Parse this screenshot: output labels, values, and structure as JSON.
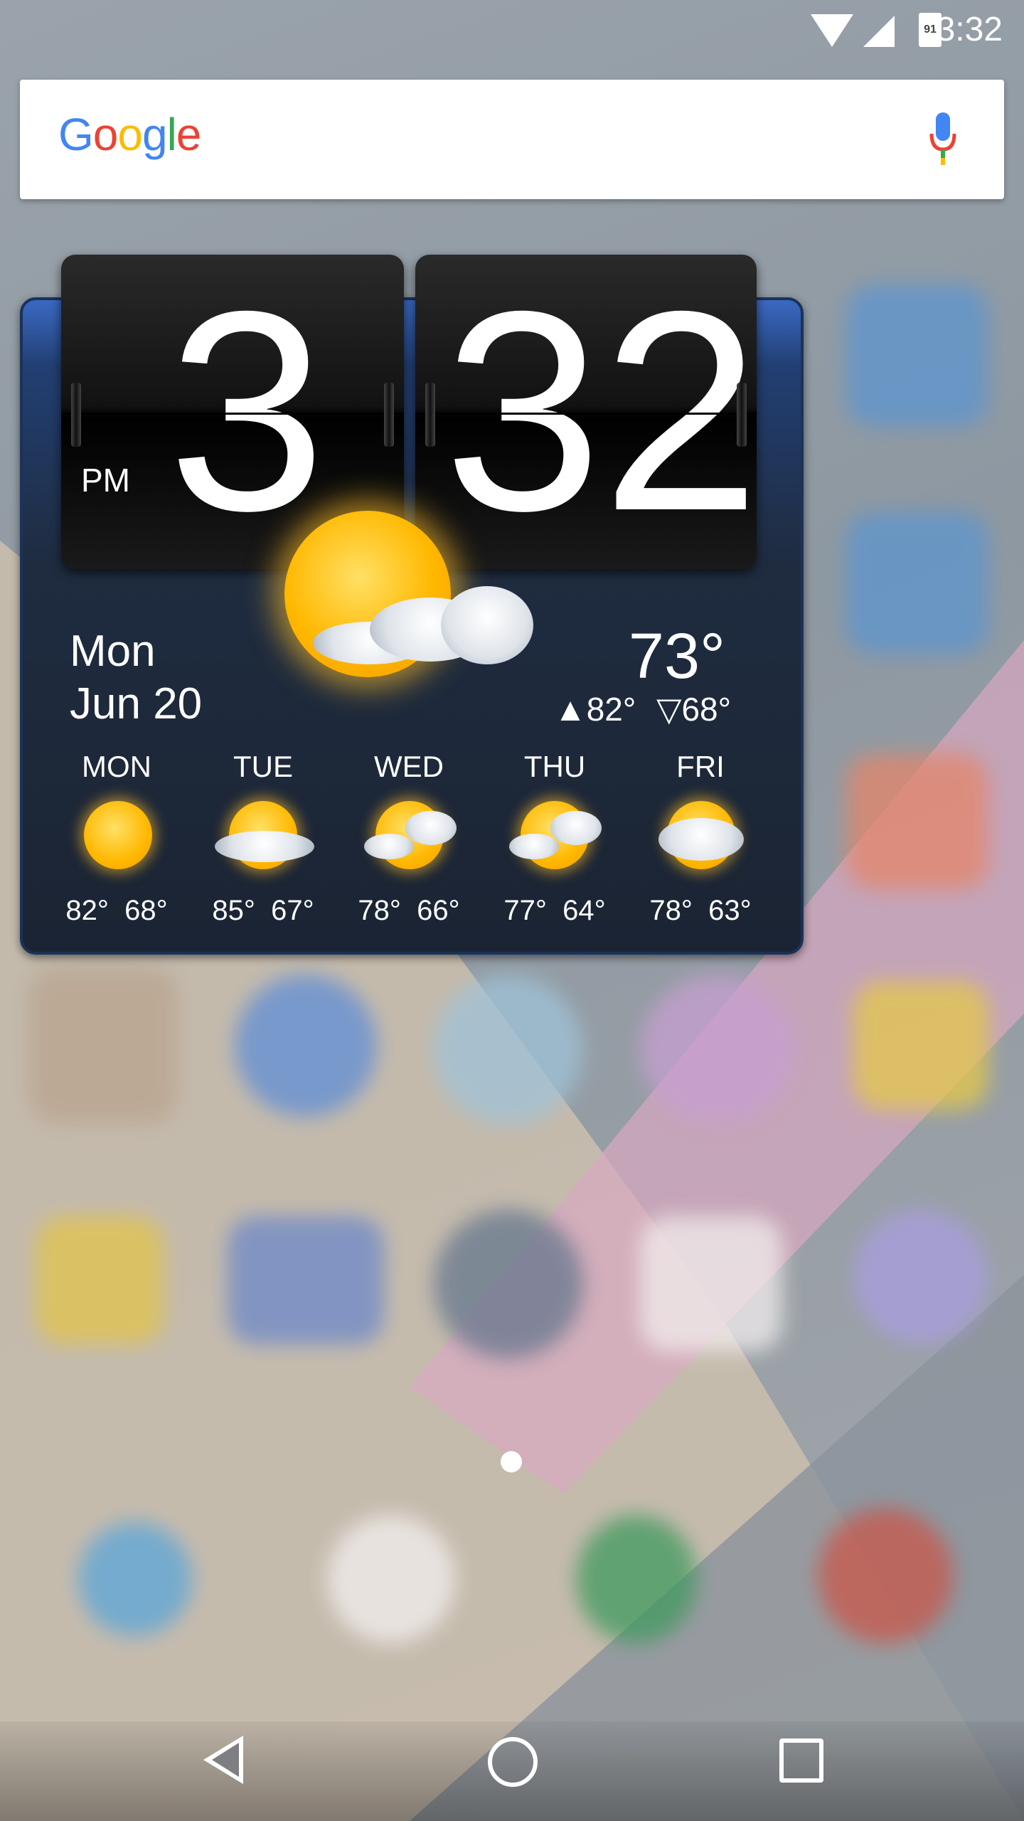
{
  "status_bar": {
    "time": "3:32",
    "battery_level": "91",
    "icons": [
      "wifi-icon",
      "signal-icon",
      "battery-icon"
    ]
  },
  "search_bar": {
    "logo_letters": [
      "G",
      "o",
      "o",
      "g",
      "l",
      "e"
    ],
    "logo_colors": [
      "#4285F4",
      "#EA4335",
      "#FBBC05",
      "#4285F4",
      "#34A853",
      "#EA4335"
    ],
    "mic_icon": "mic-icon"
  },
  "clock_widget": {
    "hour": "3",
    "minute": "32",
    "ampm": "PM",
    "day": "Mon",
    "date": "Jun 20",
    "current_temp": "73°",
    "high": "▲82°",
    "low": "▽68°",
    "current_condition_icon": "partly-sunny-icon"
  },
  "forecast": [
    {
      "day": "MON",
      "hi": "82°",
      "lo": "68°",
      "icon": "sunny-icon"
    },
    {
      "day": "TUE",
      "hi": "85°",
      "lo": "67°",
      "icon": "partly-sunny-icon"
    },
    {
      "day": "WED",
      "hi": "78°",
      "lo": "66°",
      "icon": "partly-sunny-icon"
    },
    {
      "day": "THU",
      "hi": "77°",
      "lo": "64°",
      "icon": "partly-sunny-icon"
    },
    {
      "day": "FRI",
      "hi": "78°",
      "lo": "63°",
      "icon": "partly-cloudy-icon"
    }
  ],
  "nav_bar": {
    "buttons": [
      "back-icon",
      "home-icon",
      "recents-icon"
    ]
  },
  "colors": {
    "widget_top": "#3a69c2",
    "widget_body": "#1f2c40",
    "sun": "#ffb800"
  }
}
